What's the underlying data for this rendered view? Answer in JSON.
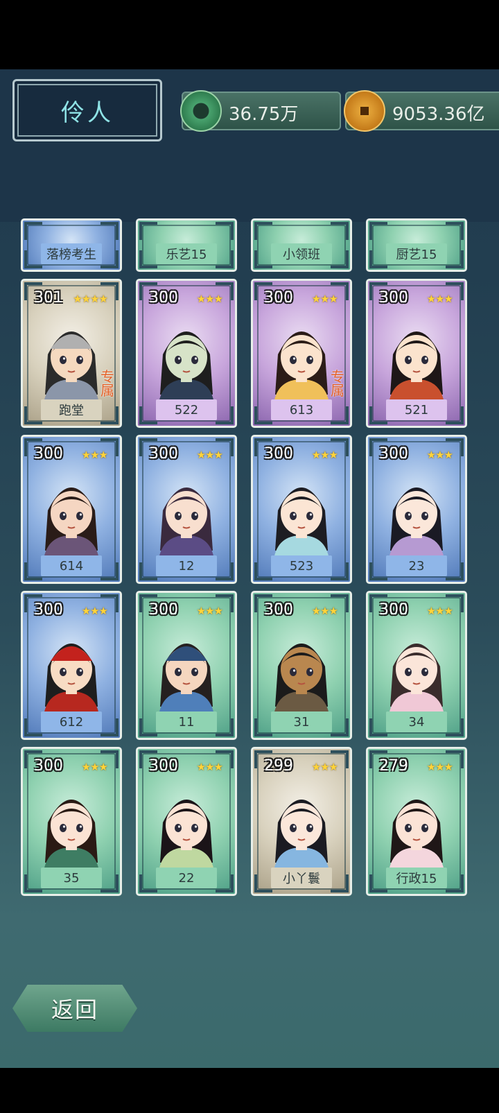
{
  "header": {
    "title": "伶人",
    "currency_jade": "36.75万",
    "currency_coin": "9053.36亿"
  },
  "partial_row": [
    {
      "name": "落榜考生",
      "color": "blue"
    },
    {
      "name": "乐艺15",
      "color": "green"
    },
    {
      "name": "小领班",
      "color": "green"
    },
    {
      "name": "厨艺15",
      "color": "green"
    }
  ],
  "cards": [
    {
      "level": "301",
      "stars": "★★★★",
      "name": "跑堂",
      "color": "grey",
      "badge": "专属",
      "skin": "#f5d9bf",
      "hair": "#2b2b2b",
      "hat": "#b0b0b0",
      "robe": "#8b96a9"
    },
    {
      "level": "300",
      "stars": "★★★",
      "name": "522",
      "color": "purple",
      "badge": "",
      "skin": "#d7e3c8",
      "hair": "#1e1e1e",
      "hat": "",
      "robe": "#2e3e56"
    },
    {
      "level": "300",
      "stars": "★★★",
      "name": "613",
      "color": "purple",
      "badge": "专属",
      "skin": "#fbe3cd",
      "hair": "#2b1c17",
      "hat": "",
      "robe": "#f0c05a"
    },
    {
      "level": "300",
      "stars": "★★★",
      "name": "521",
      "color": "purple",
      "badge": "",
      "skin": "#fbe3cd",
      "hair": "#1e1717",
      "hat": "",
      "robe": "#c9502e"
    },
    {
      "level": "300",
      "stars": "★★★",
      "name": "614",
      "color": "blue",
      "badge": "",
      "skin": "#f5d6c2",
      "hair": "#2a1c18",
      "hat": "",
      "robe": "#6b5578"
    },
    {
      "level": "300",
      "stars": "★★★",
      "name": "12",
      "color": "blue",
      "badge": "",
      "skin": "#f8dfcf",
      "hair": "#3a2a3e",
      "hat": "",
      "robe": "#5b4c85"
    },
    {
      "level": "300",
      "stars": "★★★",
      "name": "523",
      "color": "blue",
      "badge": "",
      "skin": "#fbe5d4",
      "hair": "#1d1d22",
      "hat": "",
      "robe": "#a6d9e0"
    },
    {
      "level": "300",
      "stars": "★★★",
      "name": "23",
      "color": "blue",
      "badge": "",
      "skin": "#fbe7da",
      "hair": "#1a1a24",
      "hat": "",
      "robe": "#b69ad2"
    },
    {
      "level": "300",
      "stars": "★★★",
      "name": "612",
      "color": "blue",
      "badge": "",
      "skin": "#f8dcc4",
      "hair": "#1e1e1e",
      "hat": "#c3221d",
      "robe": "#b7281f"
    },
    {
      "level": "300",
      "stars": "★★★",
      "name": "11",
      "color": "green",
      "badge": "",
      "skin": "#f5d6bf",
      "hair": "#252020",
      "hat": "#2f4f7a",
      "robe": "#4f7fba"
    },
    {
      "level": "300",
      "stars": "★★★",
      "name": "31",
      "color": "green",
      "badge": "",
      "skin": "#b9874f",
      "hair": "#1b1b1b",
      "hat": "",
      "robe": "#6b5a43"
    },
    {
      "level": "300",
      "stars": "★★★",
      "name": "34",
      "color": "green",
      "badge": "",
      "skin": "#fbe5d9",
      "hair": "#3a2c2c",
      "hat": "",
      "robe": "#f0c8d6"
    },
    {
      "level": "300",
      "stars": "★★★",
      "name": "35",
      "color": "green",
      "badge": "",
      "skin": "#fbe3d4",
      "hair": "#2a1a14",
      "hat": "",
      "robe": "#3e7d63"
    },
    {
      "level": "300",
      "stars": "★★★",
      "name": "22",
      "color": "green",
      "badge": "",
      "skin": "#fbe3d4",
      "hair": "#1b1418",
      "hat": "",
      "robe": "#bfd8a0"
    },
    {
      "level": "299",
      "stars": "★★★",
      "name": "小丫鬟",
      "color": "grey",
      "badge": "",
      "skin": "#fbe7da",
      "hair": "#1b1b22",
      "hat": "",
      "robe": "#86b6e0"
    },
    {
      "level": "279",
      "stars": "★★★",
      "name": "行政15",
      "color": "green",
      "badge": "",
      "skin": "#fbe3d6",
      "hair": "#1f1717",
      "hat": "",
      "robe": "#f4d6dd"
    }
  ],
  "back_button": "返回"
}
